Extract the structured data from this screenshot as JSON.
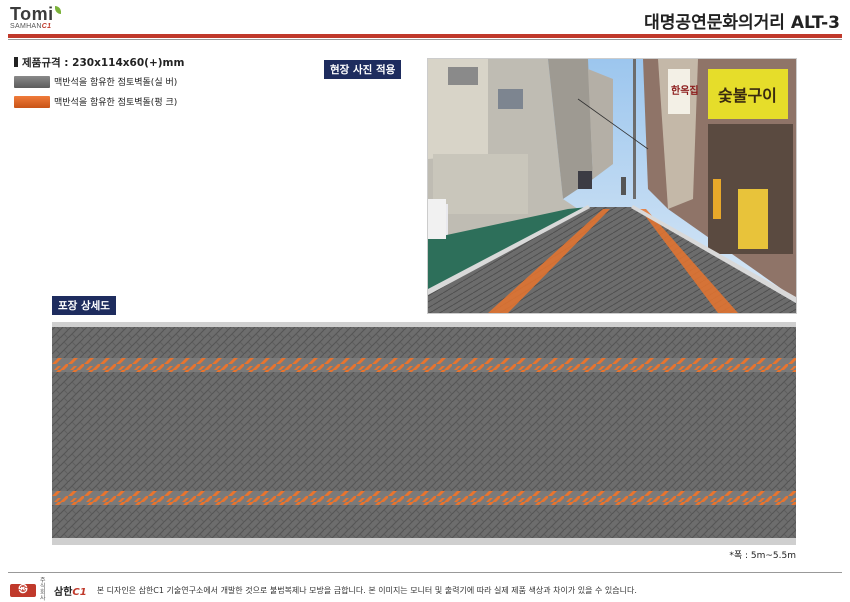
{
  "header": {
    "logo_main": "Tomi",
    "logo_sub_a": "SAMHAN",
    "logo_sub_b": "C1",
    "title": "대명공연문화의거리 ALT-3"
  },
  "spec": {
    "label": "제품규격 : 230x114x60(+)mm"
  },
  "legend": [
    {
      "label": "맥반석을 함유한 점토벽돌(실 버)",
      "color": "#6f6f6f"
    },
    {
      "label": "맥반석을 함유한 점토벽돌(펑 크)",
      "color": "#e06a2a"
    }
  ],
  "photo_section": {
    "tag": "현장 사진 적용",
    "sign_text_1": "한옥집",
    "sign_text_2": "숯불구이"
  },
  "detail_section": {
    "tag": "포장 상세도",
    "pattern": "herringbone",
    "base_color": "#6d6d6d",
    "accent_color": "#e8742e"
  },
  "note": "*폭 : 5m~5.5m",
  "footer": {
    "small_text": "주식 회사",
    "brand_a": "삼한",
    "brand_b": "C1",
    "text": "본 디자인은 삼한C1 기술연구소에서 개발한 것으로 불법복제나 모방을 금합니다. 본 이미지는 모니터 및 출력기에 따라 실제 제품 색상과 차이가 있을 수 있습니다."
  },
  "colors": {
    "accent_red": "#c0392b",
    "tag_navy": "#1e2c5e",
    "brick_gray": "#6f6f6f",
    "brick_orange": "#e06a2a"
  }
}
